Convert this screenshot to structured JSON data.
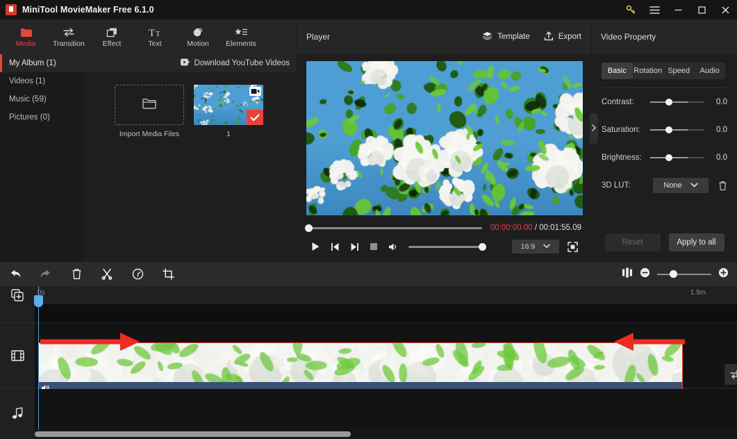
{
  "titlebar": {
    "app_title": "MiniTool MovieMaker Free 6.1.0",
    "logo_name": "minitool-logo",
    "buttons": [
      {
        "name": "key-icon",
        "label": ""
      },
      {
        "name": "menu-icon",
        "label": ""
      },
      {
        "name": "minimize-icon",
        "label": ""
      },
      {
        "name": "maximize-icon",
        "label": ""
      },
      {
        "name": "close-icon",
        "label": ""
      }
    ]
  },
  "ribbon": {
    "items": [
      {
        "label": "Media",
        "icon": "folder-icon",
        "active": true
      },
      {
        "label": "Transition",
        "icon": "transition-icon",
        "active": false
      },
      {
        "label": "Effect",
        "icon": "effect-icon",
        "active": false
      },
      {
        "label": "Text",
        "icon": "text-icon",
        "active": false
      },
      {
        "label": "Motion",
        "icon": "motion-icon",
        "active": false
      },
      {
        "label": "Elements",
        "icon": "elements-icon",
        "active": false
      }
    ]
  },
  "media": {
    "albums": [
      {
        "label": "My Album (1)",
        "active": true
      },
      {
        "label": "Videos (1)",
        "active": false
      },
      {
        "label": "Music (59)",
        "active": false
      },
      {
        "label": "Pictures (0)",
        "active": false
      }
    ],
    "download_label": "Download YouTube Videos",
    "download_icon": "youtube-download-icon",
    "import_label": "Import Media Files",
    "import_icon": "folder-open-icon",
    "clip_label": "1",
    "clip_badge_icon": "video-camera-icon",
    "clip_selected_icon": "check-icon"
  },
  "player": {
    "title": "Player",
    "template_label": "Template",
    "template_icon": "layers-icon",
    "export_label": "Export",
    "export_icon": "export-upload-icon",
    "current_time": "00:00:00.00",
    "time_separator": "/",
    "total_time": "00:01:55.09",
    "controls": [
      {
        "name": "play-button",
        "icon": "play-icon"
      },
      {
        "name": "previous-frame-button",
        "icon": "skip-back-icon"
      },
      {
        "name": "next-frame-button",
        "icon": "skip-forward-icon"
      },
      {
        "name": "stop-button",
        "icon": "stop-icon"
      },
      {
        "name": "volume-button",
        "icon": "speaker-icon"
      }
    ],
    "aspect_ratio": "16:9",
    "fullscreen_icon": "fullscreen-icon",
    "collapse_icon": "chevron-right-icon",
    "progress_percent": 0,
    "volume_percent": 100
  },
  "property": {
    "title": "Video Property",
    "tabs": [
      {
        "label": "Basic",
        "active": true
      },
      {
        "label": "Rotation",
        "active": false
      },
      {
        "label": "Speed",
        "active": false
      },
      {
        "label": "Audio",
        "active": false
      }
    ],
    "sliders": [
      {
        "label": "Contrast:",
        "value": "0.0"
      },
      {
        "label": "Saturation:",
        "value": "0.0"
      },
      {
        "label": "Brightness:",
        "value": "0.0"
      }
    ],
    "lut_label": "3D LUT:",
    "lut_value": "None",
    "lut_delete_icon": "trash-icon",
    "reset_label": "Reset",
    "apply_label": "Apply to all"
  },
  "timeline": {
    "tools": [
      {
        "name": "undo-button",
        "icon": "undo-icon",
        "enabled": true
      },
      {
        "name": "redo-button",
        "icon": "redo-icon",
        "enabled": false
      },
      {
        "name": "delete-button",
        "icon": "trash-icon",
        "enabled": true
      },
      {
        "name": "split-button",
        "icon": "scissors-icon",
        "enabled": true
      },
      {
        "name": "speed-button",
        "icon": "speedometer-icon",
        "enabled": true
      },
      {
        "name": "crop-button",
        "icon": "crop-icon",
        "enabled": true
      }
    ],
    "split-screen_icon": "split-view-icon",
    "zoom_out_icon": "zoom-out-icon",
    "zoom_in_icon": "zoom-in-icon",
    "zoom_percent": 24,
    "ruler_start": "0s",
    "ruler_end": "1.9m",
    "track_headers": [
      {
        "name": "add-track-icon",
        "icon": "add-media-icon"
      },
      {
        "name": "video-track-icon",
        "icon": "film-icon"
      },
      {
        "name": "audio-track-icon",
        "icon": "music-note-icon"
      }
    ],
    "clip_audio_icon": "speaker-icon",
    "transition_icon": "transition-arrows-icon"
  },
  "annotations": {
    "arrow_color": "#ef2b22",
    "left_arrow_name": "left-red-arrow",
    "right_arrow_name": "right-red-arrow"
  },
  "colors": {
    "accent_red": "#e8433a",
    "panel_bg": "#1e1e1e",
    "header_bg": "#262626",
    "playhead_blue": "#5aafe8",
    "audio_band": "#3d5073"
  }
}
